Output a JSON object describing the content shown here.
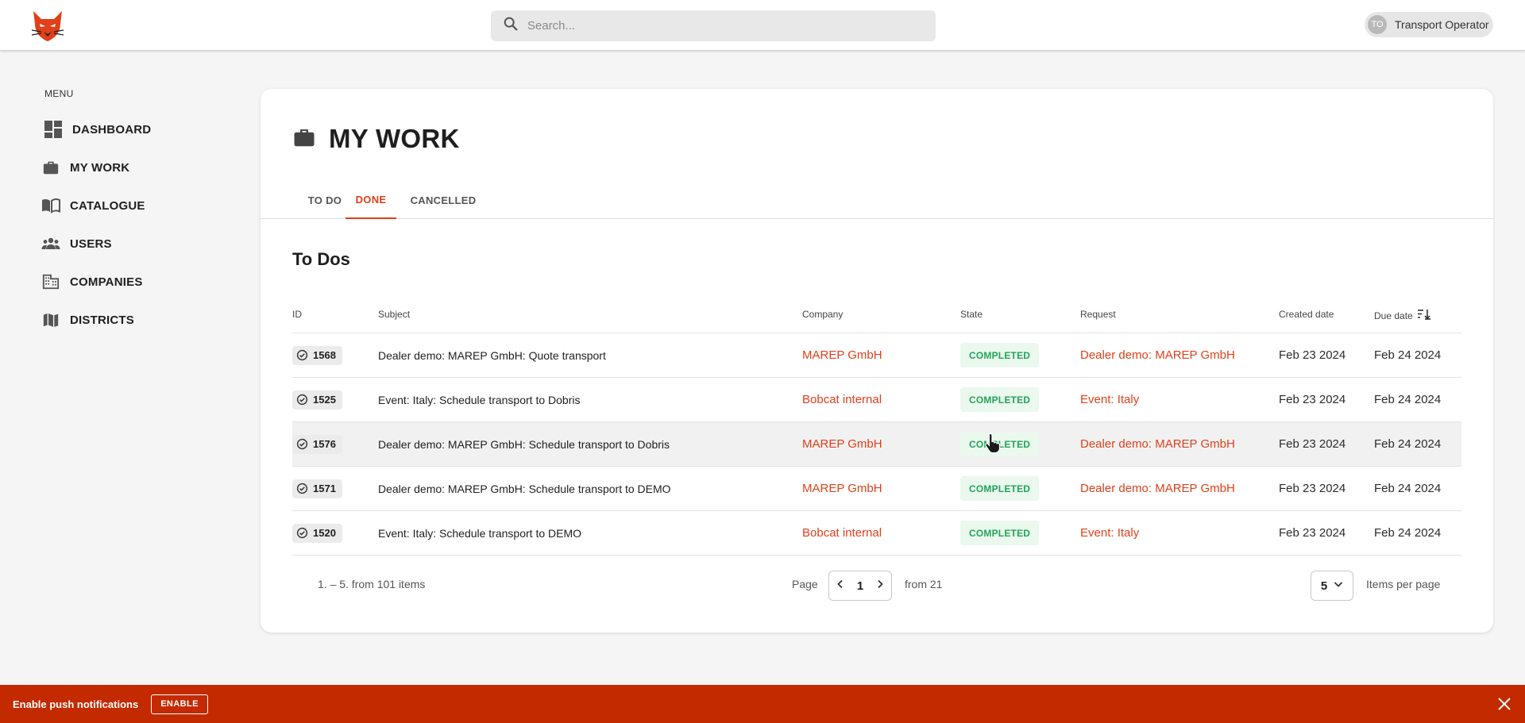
{
  "header": {
    "logo": "bobcat-logo",
    "search": {
      "placeholder": "Search..."
    },
    "user": {
      "initials": "TO",
      "name": "Transport Operator"
    }
  },
  "sidebar": {
    "menu_title": "MENU",
    "items": [
      {
        "label": "DASHBOARD",
        "icon": "dashboard-icon"
      },
      {
        "label": "MY WORK",
        "icon": "briefcase-icon"
      },
      {
        "label": "CATALOGUE",
        "icon": "book-icon"
      },
      {
        "label": "USERS",
        "icon": "users-icon"
      },
      {
        "label": "COMPANIES",
        "icon": "building-icon"
      },
      {
        "label": "DISTRICTS",
        "icon": "map-icon"
      }
    ]
  },
  "main": {
    "title": "MY WORK",
    "tabs": [
      {
        "label": "TO DO",
        "active": false
      },
      {
        "label": "DONE",
        "active": true
      },
      {
        "label": "CANCELLED",
        "active": false
      }
    ],
    "section_title": "To Dos",
    "table": {
      "columns": [
        "ID",
        "Subject",
        "Company",
        "State",
        "Request",
        "Created date",
        "Due date"
      ],
      "rows": [
        {
          "id": "1568",
          "subject": "Dealer demo: MAREP GmbH: Quote transport",
          "company": "MAREP GmbH",
          "state": "COMPLETED",
          "request": "Dealer demo: MAREP GmbH",
          "created": "Feb 23 2024",
          "due": "Feb 24 2024"
        },
        {
          "id": "1525",
          "subject": "Event: Italy: Schedule transport to Dobris",
          "company": "Bobcat internal",
          "state": "COMPLETED",
          "request": "Event: Italy",
          "created": "Feb 23 2024",
          "due": "Feb 24 2024"
        },
        {
          "id": "1576",
          "subject": "Dealer demo: MAREP GmbH: Schedule transport to Dobris",
          "company": "MAREP GmbH",
          "state": "COMPLETED",
          "request": "Dealer demo: MAREP GmbH",
          "created": "Feb 23 2024",
          "due": "Feb 24 2024"
        },
        {
          "id": "1571",
          "subject": "Dealer demo: MAREP GmbH: Schedule transport to DEMO",
          "company": "MAREP GmbH",
          "state": "COMPLETED",
          "request": "Dealer demo: MAREP GmbH",
          "created": "Feb 23 2024",
          "due": "Feb 24 2024"
        },
        {
          "id": "1520",
          "subject": "Event: Italy: Schedule transport to DEMO",
          "company": "Bobcat internal",
          "state": "COMPLETED",
          "request": "Event: Italy",
          "created": "Feb 23 2024",
          "due": "Feb 24 2024"
        }
      ]
    },
    "pagination": {
      "range_text": "1. – 5. from 101 items",
      "page_label": "Page",
      "current_page": "1",
      "total_text": "from 21",
      "per_page": "5",
      "per_page_label": "Items per page"
    }
  },
  "banner": {
    "text": "Enable push notifications",
    "button": "ENABLE"
  },
  "colors": {
    "accent": "#e0401a",
    "banner": "#c42a00",
    "completed": "#23a55a",
    "completed_bg": "#eaf8ee"
  }
}
